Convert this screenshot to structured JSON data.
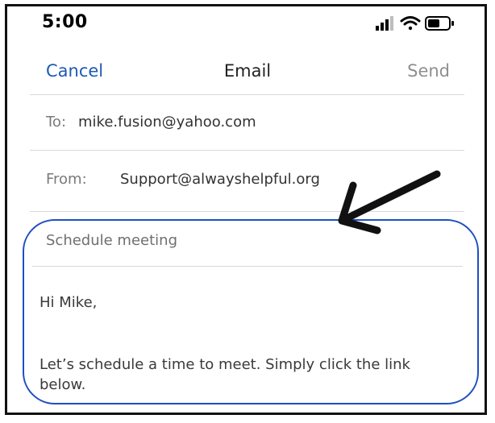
{
  "status_bar": {
    "time": "5:00",
    "icons": [
      "signal-icon",
      "wifi-icon",
      "battery-icon"
    ]
  },
  "nav": {
    "cancel_label": "Cancel",
    "title": "Email",
    "send_label": "Send"
  },
  "fields": {
    "to_label": "To:",
    "to_value": "mike.fusion@yahoo.com",
    "from_label": "From:",
    "from_value": "Support@alwayshelpful.org"
  },
  "message": {
    "subject": "Schedule meeting",
    "greeting": "Hi Mike,",
    "body_line1": "Let’s schedule a time to meet. Simply click the link",
    "body_line2": "below."
  },
  "colors": {
    "accent": "#1e5ab5",
    "highlight_border": "#1f4fbf",
    "arrow": "#111111",
    "send_disabled": "#8f8f8f"
  },
  "annotation": {
    "arrow": "arrow-pointing-to-subject",
    "highlight": "rounded-rectangle-around-message"
  }
}
